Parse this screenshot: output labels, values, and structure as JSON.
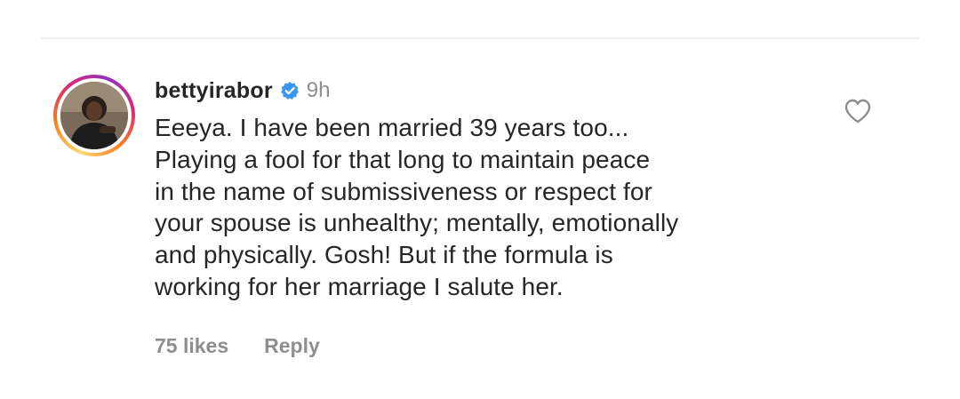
{
  "comment": {
    "username": "bettyirabor",
    "verified_icon": "verified-badge-icon",
    "time": "9h",
    "lines": [
      "Eeeya. I have been married 39 years too...",
      "Playing a fool for that long to maintain peace",
      "in the name of submissiveness or respect for",
      "your spouse is unhealthy; mentally, emotionally",
      "and physically. Gosh! But if the formula is",
      "working for her marriage I salute her."
    ],
    "likes": "75 likes",
    "reply_label": "Reply",
    "like_icon": "heart-icon"
  },
  "colors": {
    "verified": "#3897f0",
    "muted": "#8e8e8e",
    "text": "#262626"
  }
}
